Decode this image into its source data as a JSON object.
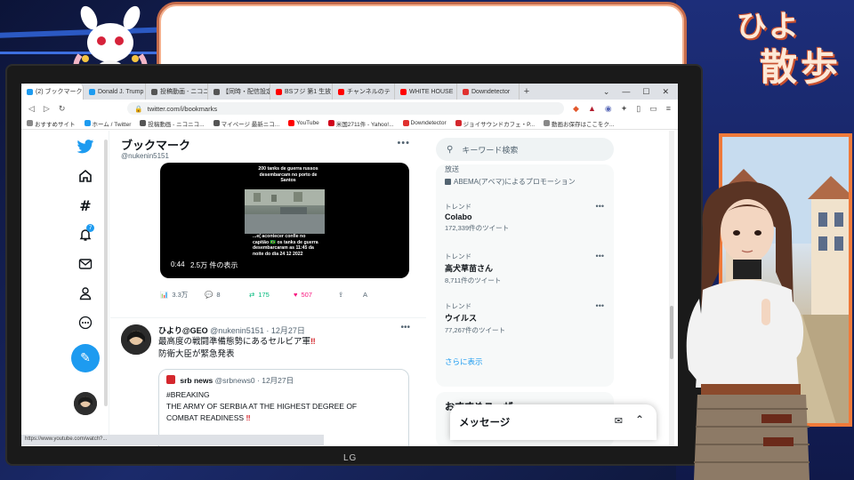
{
  "stream": {
    "title_hiyo": "ひよ",
    "title_sanpo": "散歩",
    "speech_bubble_text": "",
    "monitor_brand": "LG"
  },
  "browser": {
    "tabs": [
      {
        "label": "(2) ブックマーク",
        "icon_color": "#1d9bf0",
        "active": true
      },
      {
        "label": "Donald J. Trump",
        "icon_color": "#1d9bf0",
        "active": false
      },
      {
        "label": "投稿動画 - ニコニ",
        "icon_color": "#555555",
        "active": false
      },
      {
        "label": "【同時・配信設定】",
        "icon_color": "#555555",
        "active": false
      },
      {
        "label": "BSフジ 第1 生放",
        "icon_color": "#ff0000",
        "active": false
      },
      {
        "label": "チャンネルのテ",
        "icon_color": "#ff0000",
        "active": false
      },
      {
        "label": "WHITE HOUSE",
        "icon_color": "#ff0000",
        "active": false
      },
      {
        "label": "Downdetector",
        "icon_color": "#e0312f",
        "active": false
      }
    ],
    "new_tab_label": "+",
    "window_controls": [
      "⌄",
      "—",
      "☐",
      "✕"
    ],
    "url": "twitter.com/i/bookmarks",
    "bookmarks": [
      {
        "label": "おすすめサイト",
        "icon_color": "#888888"
      },
      {
        "label": "ホーム / Twitter",
        "icon_color": "#1d9bf0"
      },
      {
        "label": "投稿動画 - ニコニコ...",
        "icon_color": "#555555"
      },
      {
        "label": "マイページ 最新ニコ...",
        "icon_color": "#555555"
      },
      {
        "label": "YouTube",
        "icon_color": "#ff0000"
      },
      {
        "label": "米国2711件 - Yahoo!...",
        "icon_color": "#d0021b"
      },
      {
        "label": "Downdetector",
        "icon_color": "#e0312f"
      },
      {
        "label": "ジョイサウンドカフェ・P...",
        "icon_color": "#d4272d"
      },
      {
        "label": "動画お保存はここをク...",
        "icon_color": "#888888"
      }
    ],
    "status_url": "https://www.youtube.com/watch?..."
  },
  "twitter": {
    "nav_icons": [
      "twitter-logo-icon",
      "home-icon",
      "explore-icon",
      "notifications-icon",
      "messages-icon",
      "profile-icon",
      "more-icon"
    ],
    "notification_badge": "7",
    "page_title": "ブックマーク",
    "page_handle": "@nukenin5151",
    "more_label": "•••",
    "video": {
      "caption_top": "200 tanks de guerra russos desembarcam no porto de Santos",
      "caption_bottom": "...e( acontecer confie no capitão 🇧🇷 os tanks de guerra desembarcaram as 11:45 da noite do dia 24 12 2022",
      "time": "0:44",
      "views": "2.5万 件の表示"
    },
    "actions": {
      "views": "3.3万",
      "replies": "8",
      "retweets": "175",
      "likes": "507"
    },
    "tweet2": {
      "name": "ひより@GEO",
      "handle": "@nukenin5151",
      "date": "12月27日",
      "line1": "最高度の戦闘準備態勢にあるセルビア軍",
      "line1_mark": "‼",
      "line2": "防衛大臣が緊急発表"
    },
    "quote": {
      "name": "srb news",
      "handle": "@srbnews0",
      "date": "12月27日",
      "line1": "#BREAKING",
      "line2": "THE ARMY OF SERBIA AT THE HIGHEST DEGREE OF",
      "line3": "COMBAT READINESS",
      "line3_mark": "‼"
    },
    "search_placeholder": "キーワード検索",
    "promo": {
      "label": "放送",
      "text": "ABEMA(アベマ)によるプロモーション"
    },
    "trends": [
      {
        "label": "トレンド",
        "name": "Colabo",
        "count": "172,339件のツイート"
      },
      {
        "label": "トレンド",
        "name": "高犬草苗さん",
        "count": "8,711件のツイート"
      },
      {
        "label": "トレンド",
        "name": "ウイルス",
        "count": "77,267件のツイート"
      }
    ],
    "show_more": "さらに表示",
    "recommendations_title": "おすすめユーザー",
    "messages_title": "メッセージ"
  },
  "colors": {
    "twitter_blue": "#1d9bf0",
    "retweet_green": "#00ba7c",
    "like_pink": "#f91880",
    "bubble_border": "#c46a4a",
    "scene_frame": "#f07a3a"
  }
}
